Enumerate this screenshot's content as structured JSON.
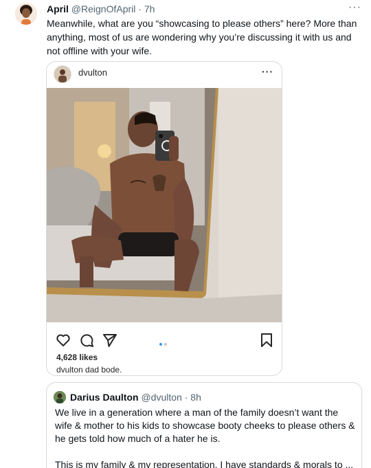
{
  "tweet": {
    "name": "April",
    "handle": "@ReignOfApril",
    "separator": "·",
    "time": "7h",
    "more": "···",
    "text": "Meanwhile, what are you “showcasing to please others” here? More than anything, most of us are wondering why you’re discussing it with us and not offline with your wife."
  },
  "instagram": {
    "username": "dvulton",
    "more": "···",
    "likes": "4,628 likes",
    "caption": "dvulton dad bode.",
    "carousel_active_color": "#3897f0",
    "carousel_inactive_color": "#c7c7c7"
  },
  "quote": {
    "name": "Darius Daulton",
    "handle": "@dvulton",
    "separator": "·",
    "time": "8h",
    "text_p1": "We live in a generation where a man of the family doesn’t want the wife & mother to his kids to showcase booty cheeks to please others & he gets told how much of a hater he is.",
    "text_p2": "This is my family & my representation. I have standards & morals to ..."
  },
  "colors": {
    "text_primary": "#0f1419",
    "text_secondary": "#536471",
    "border": "#d5dbe0"
  },
  "icons": {
    "like": "heart-icon",
    "comment": "comment-icon",
    "share": "send-icon",
    "save": "bookmark-icon"
  }
}
